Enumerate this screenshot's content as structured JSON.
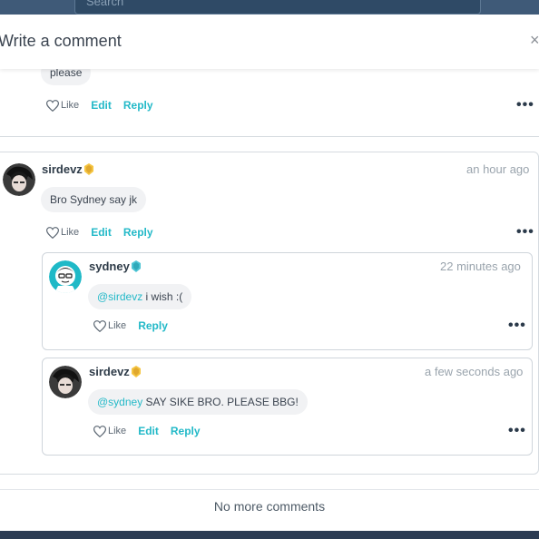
{
  "background": {
    "search_placeholder": "Search"
  },
  "modal": {
    "title": "Write a comment",
    "close_glyph": "×"
  },
  "first_comment": {
    "text": "please",
    "actions": {
      "like": "Like",
      "edit": "Edit",
      "reply": "Reply"
    },
    "more": "•••"
  },
  "thread": {
    "comment": {
      "username": "sirdevz",
      "badge_color": "#f5c542",
      "time": "an hour ago",
      "text": "Bro Sydney say jk",
      "actions": {
        "like": "Like",
        "edit": "Edit",
        "reply": "Reply"
      },
      "more": "•••"
    },
    "replies": [
      {
        "username": "sydney",
        "badge_color": "#4dc4d4",
        "time": "22 minutes ago",
        "mention": "@sirdevz",
        "text": " i wish :(",
        "actions": {
          "like": "Like",
          "reply": "Reply"
        },
        "more": "•••"
      },
      {
        "username": "sirdevz",
        "badge_color": "#f5c542",
        "time": "a few seconds ago",
        "mention": "@sydney",
        "text": " SAY SIKE BRO. PLEASE BBG!",
        "actions": {
          "like": "Like",
          "edit": "Edit",
          "reply": "Reply"
        },
        "more": "•••"
      }
    ]
  },
  "footer": {
    "no_more": "No more comments"
  },
  "colors": {
    "accent": "#23b9c8",
    "text": "#3b4450",
    "muted": "#9aa4ad"
  }
}
